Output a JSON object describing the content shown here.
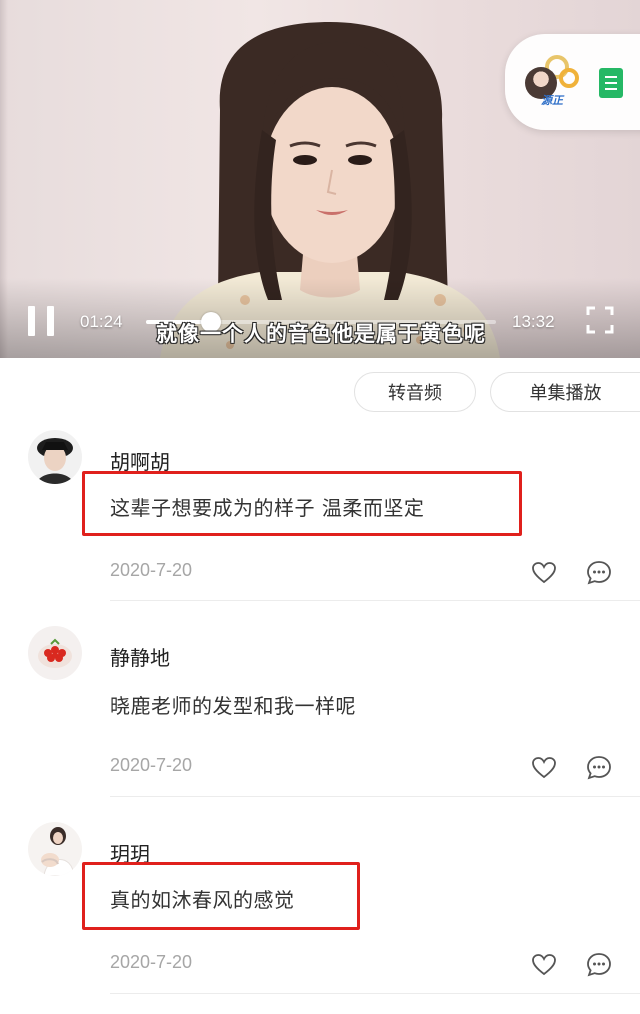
{
  "player": {
    "current_time": "01:24",
    "total_time": "13:32",
    "progress": 0.185,
    "subtitle": "就像一个人的音色他是属于黄色呢",
    "pause_icon": "pause-icon",
    "fullscreen_icon": "fullscreen-icon",
    "floating_tag": "源正"
  },
  "actions": {
    "audio_label": "转音频",
    "episode_label": "单集播放"
  },
  "comments": [
    {
      "username": "胡啊胡",
      "text": "这辈子想要成为的样子  温柔而坚定",
      "date": "2020-7-20",
      "highlighted": true
    },
    {
      "username": "静静地",
      "text": "晓鹿老师的发型和我一样呢",
      "date": "2020-7-20",
      "highlighted": false
    },
    {
      "username": "玥玥",
      "text": "真的如沐春风的感觉",
      "date": "2020-7-20",
      "highlighted": true
    }
  ],
  "colors": {
    "highlight": "#e0201c",
    "date": "#a6a6a6",
    "pill_border": "#e2e2e2"
  }
}
